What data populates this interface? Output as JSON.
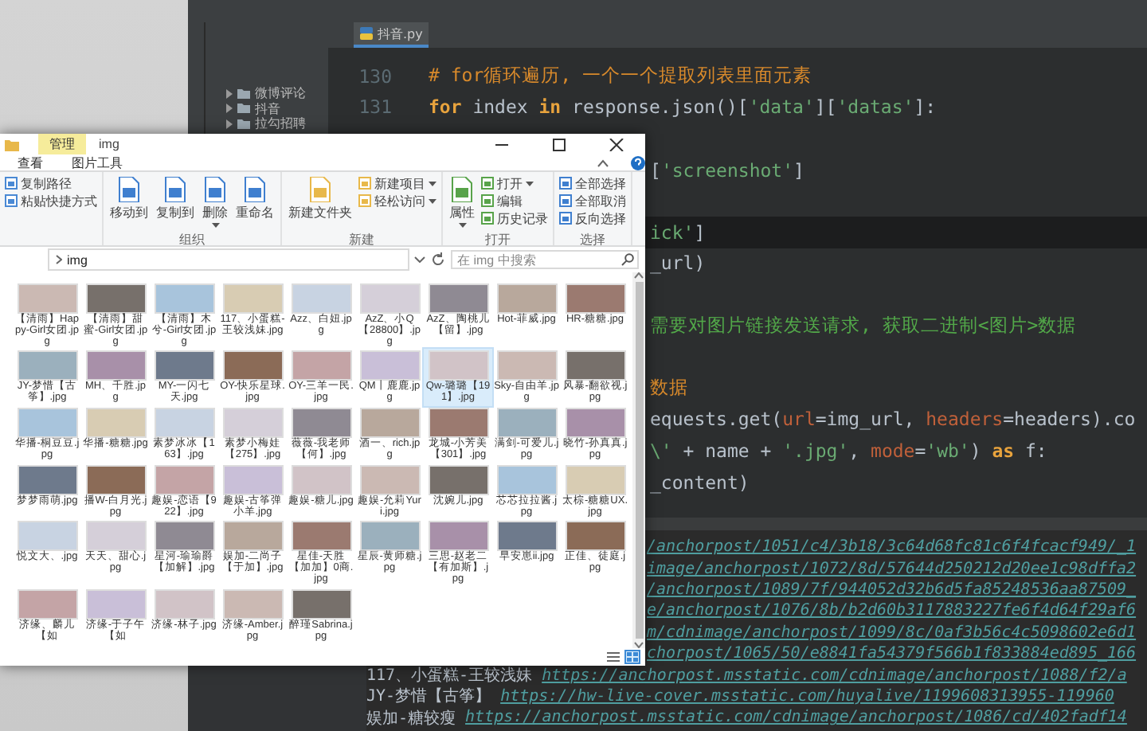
{
  "editor": {
    "project_tree": [
      {
        "label": "微博评论",
        "expanded": false
      },
      {
        "label": "抖音",
        "expanded": false
      },
      {
        "label": "拉勾招聘",
        "expanded": false
      }
    ],
    "tabs": [
      {
        "label": "抖音.py",
        "selected": true
      }
    ],
    "code_lines": [
      {
        "kind": "full",
        "number": "130",
        "current": false,
        "tokens": [
          {
            "kind": "comment",
            "text": "# for循环遍历, 一个一个提取列表里面元素"
          }
        ]
      },
      {
        "kind": "full",
        "number": "131",
        "current": false,
        "tokens": [
          {
            "kind": "keyword",
            "text": "for"
          },
          {
            "kind": "plain",
            "text": " index "
          },
          {
            "kind": "keyword",
            "text": "in"
          },
          {
            "kind": "plain",
            "text": " response.json()["
          },
          {
            "kind": "string",
            "text": "'data'"
          },
          {
            "kind": "plain",
            "text": "]["
          },
          {
            "kind": "string",
            "text": "'datas'"
          },
          {
            "kind": "plain",
            "text": "]:"
          }
        ]
      },
      {
        "kind": "clipped",
        "current": false
      },
      {
        "kind": "clipped",
        "current": false,
        "tokens": [
          {
            "kind": "plain",
            "text": "["
          },
          {
            "kind": "string",
            "text": "'screenshot'"
          },
          {
            "kind": "plain",
            "text": "]"
          }
        ]
      },
      {
        "kind": "clipped",
        "current": false
      },
      {
        "kind": "clipped",
        "current": true,
        "tokens": [
          {
            "kind": "string",
            "text": "ick'"
          },
          {
            "kind": "plain",
            "text": "]"
          }
        ]
      },
      {
        "kind": "clipped",
        "current": false,
        "tokens": [
          {
            "kind": "plain",
            "text": "_url)"
          }
        ]
      },
      {
        "kind": "clipped",
        "current": false
      },
      {
        "kind": "clipped",
        "current": false,
        "tokens": [
          {
            "kind": "note",
            "text": "需要对图片链接发送请求, 获取二进制<图片>数据"
          }
        ]
      },
      {
        "kind": "clipped",
        "current": false
      },
      {
        "kind": "clipped",
        "current": false,
        "tokens": [
          {
            "kind": "comment",
            "text": "数据"
          }
        ]
      },
      {
        "kind": "clipped",
        "current": false,
        "tokens": [
          {
            "kind": "plain",
            "text": "equests.get("
          },
          {
            "kind": "param",
            "text": "url"
          },
          {
            "kind": "plain",
            "text": "=img_url, "
          },
          {
            "kind": "param",
            "text": "headers"
          },
          {
            "kind": "plain",
            "text": "=headers).co"
          }
        ]
      },
      {
        "kind": "clipped",
        "current": false,
        "tokens": [
          {
            "kind": "string",
            "text": "\\'"
          },
          {
            "kind": "plain",
            "text": " + name + "
          },
          {
            "kind": "string",
            "text": "'.jpg'"
          },
          {
            "kind": "plain",
            "text": ", "
          },
          {
            "kind": "param",
            "text": "mode"
          },
          {
            "kind": "plain",
            "text": "="
          },
          {
            "kind": "string",
            "text": "'wb'"
          },
          {
            "kind": "plain",
            "text": ") "
          },
          {
            "kind": "keyword",
            "text": "as"
          },
          {
            "kind": "plain",
            "text": " f:"
          }
        ]
      },
      {
        "kind": "clipped",
        "current": false,
        "tokens": [
          {
            "kind": "plain",
            "text": "_content)"
          }
        ]
      }
    ],
    "run_output": [
      {
        "kind": "clipped",
        "url": "/anchorpost/1051/c4/3b18/3c64d68fc81c6f4fcacf949/_1"
      },
      {
        "kind": "clipped",
        "url": "image/anchorpost/1072/8d/57644d250212d20ee1c98dffa2"
      },
      {
        "kind": "clipped",
        "url": "/anchorpost/1089/7f/944052d32b6d5fa85248536aa87509_"
      },
      {
        "kind": "clipped",
        "url": "e/anchorpost/1076/8b/b2d60b3117883227fe6f4d64f29af6"
      },
      {
        "kind": "clipped",
        "url": "m/cdnimage/anchorpost/1099/8c/0af3b56c4c5098602e6d1"
      },
      {
        "kind": "clipped",
        "url": "chorpost/1065/50/e8841fa54379f566b1f833884ed895_166"
      },
      {
        "kind": "full",
        "name": "117、小蛋糕-王较浅妹",
        "url": "https://anchorpost.msstatic.com/cdnimage/anchorpost/1088/f2/a"
      },
      {
        "kind": "full",
        "name": "JY-梦惜【古筝】",
        "url": "https://hw-live-cover.msstatic.com/huyalive/1199608313955-119960"
      },
      {
        "kind": "full",
        "name": "娱加-糖较瘦",
        "url": "https://anchorpost.msstatic.com/cdnimage/anchorpost/1086/cd/402fadf14"
      }
    ]
  },
  "explorer": {
    "context_tab": "管理",
    "title": "img",
    "ribbon_tabs": [
      {
        "label": "查看",
        "selected": false
      },
      {
        "label": "图片工具",
        "selected": false
      }
    ],
    "ribbon_groups": [
      {
        "items": [
          {
            "label": "复制路径",
            "kind": "small",
            "dropdown": false
          },
          {
            "label": "粘贴快捷方式",
            "kind": "small",
            "dropdown": false
          }
        ]
      },
      {
        "label": "组织",
        "items": [
          {
            "label": "移动到",
            "kind": "large",
            "dropdown": false
          },
          {
            "label": "复制到",
            "kind": "large",
            "dropdown": false
          },
          {
            "label": "删除",
            "kind": "large",
            "dropdown": true
          },
          {
            "label": "重命名",
            "kind": "large",
            "dropdown": false
          }
        ]
      },
      {
        "label": "新建",
        "items": [
          {
            "label": "新建文件夹",
            "kind": "large",
            "dropdown": false
          },
          {
            "label": "新建项目",
            "kind": "small",
            "dropdown": true
          },
          {
            "label": "轻松访问",
            "kind": "small",
            "dropdown": true
          }
        ]
      },
      {
        "label": "打开",
        "items": [
          {
            "label": "属性",
            "kind": "large",
            "dropdown": true
          },
          {
            "label": "打开",
            "kind": "small",
            "dropdown": true
          },
          {
            "label": "编辑",
            "kind": "small",
            "dropdown": false
          },
          {
            "label": "历史记录",
            "kind": "small",
            "dropdown": false
          }
        ]
      },
      {
        "label": "选择",
        "items": [
          {
            "label": "全部选择",
            "kind": "small",
            "dropdown": false
          },
          {
            "label": "全部取消",
            "kind": "small",
            "dropdown": false
          },
          {
            "label": "反向选择",
            "kind": "small",
            "dropdown": false
          }
        ]
      }
    ],
    "address_path": [
      "img"
    ],
    "search_placeholder": "在 img 中搜索",
    "files": [
      {
        "name": "【清雨】Happy-Girl女团.jpg",
        "selected": false
      },
      {
        "name": "【清雨】甜蜜-Girl女团.jpg",
        "selected": false
      },
      {
        "name": "【清雨】木兮-Girl女团.jpg",
        "selected": false
      },
      {
        "name": "117、小蛋糕-王较浅妹.jpg",
        "selected": false
      },
      {
        "name": "Azz、白妞.jpg",
        "selected": false
      },
      {
        "name": "AzZ、小Q【28800】.jpg",
        "selected": false
      },
      {
        "name": "AzZ、陶桃儿【留】.jpg",
        "selected": false
      },
      {
        "name": "Hot-菲威.jpg",
        "selected": false
      },
      {
        "name": "HR-糖糖.jpg",
        "selected": false
      },
      {
        "name": "JY-梦惜【古筝】.jpg",
        "selected": false
      },
      {
        "name": "MH、千胜.jpg",
        "selected": false
      },
      {
        "name": "MY-一闪七天.jpg",
        "selected": false
      },
      {
        "name": "OY-快乐星球.jpg",
        "selected": false
      },
      {
        "name": "OY-三羊一民.jpg",
        "selected": false
      },
      {
        "name": "QM丨鹿鹿.jpg",
        "selected": false
      },
      {
        "name": "Qw-璐璐【191】.jpg",
        "selected": true
      },
      {
        "name": "Sky-自由羊.jpg",
        "selected": false
      },
      {
        "name": "风暴-翻欲视.jpg",
        "selected": false
      },
      {
        "name": "华播-桐豆豆.jpg",
        "selected": false
      },
      {
        "name": "华播-糖糖.jpg",
        "selected": false
      },
      {
        "name": "素梦冰冰【163】.jpg",
        "selected": false
      },
      {
        "name": "素梦小梅娃【275】.jpg",
        "selected": false
      },
      {
        "name": "薇薇-我老师【何】.jpg",
        "selected": false
      },
      {
        "name": "酒一、rich.jpg",
        "selected": false
      },
      {
        "name": "龙城-小芳美【301】.jpg",
        "selected": false
      },
      {
        "name": "满剑-可爱儿.jpg",
        "selected": false
      },
      {
        "name": "晓竹-孙真真.jpg",
        "selected": false
      },
      {
        "name": "梦梦雨萌.jpg",
        "selected": false
      },
      {
        "name": "播W-白月光.jpg",
        "selected": false
      },
      {
        "name": "趣娱-恋语【922】.jpg",
        "selected": false
      },
      {
        "name": "趣娱-古筝弹小羊.jpg",
        "selected": false
      },
      {
        "name": "趣娱-糖儿.jpg",
        "selected": false
      },
      {
        "name": "趣娱-允莉Yuri.jpg",
        "selected": false
      },
      {
        "name": "沈婉儿.jpg",
        "selected": false
      },
      {
        "name": "芯芯拉拉酱.jpg",
        "selected": false
      },
      {
        "name": "太棕-糖糖UX.jpg",
        "selected": false
      },
      {
        "name": "悦文大、.jpg",
        "selected": false
      },
      {
        "name": "天天、甜心.jpg",
        "selected": false
      },
      {
        "name": "星河-瑜瑜爵【加解】.jpg",
        "selected": false
      },
      {
        "name": "娱加-二尚子【于加】.jpg",
        "selected": false
      },
      {
        "name": "星佳-天胜【加加】0商.jpg",
        "selected": false
      },
      {
        "name": "星辰-黄师糖.jpg",
        "selected": false
      },
      {
        "name": "三思-赵老二【有加斯】.jpg",
        "selected": false
      },
      {
        "name": "早安崽ii.jpg",
        "selected": false
      },
      {
        "name": "正佳、徒庭.jpg",
        "selected": false
      },
      {
        "name": "济缘、麟儿【如",
        "selected": false
      },
      {
        "name": "济缘-于子午【如",
        "selected": false
      },
      {
        "name": "济缘-林子.jpg",
        "selected": false
      },
      {
        "name": "济缘-Amber.jpg",
        "selected": false
      },
      {
        "name": "醉瑾Sabrina.jpg",
        "selected": false
      }
    ],
    "view_buttons": [
      {
        "selected": false
      },
      {
        "selected": true
      }
    ]
  }
}
